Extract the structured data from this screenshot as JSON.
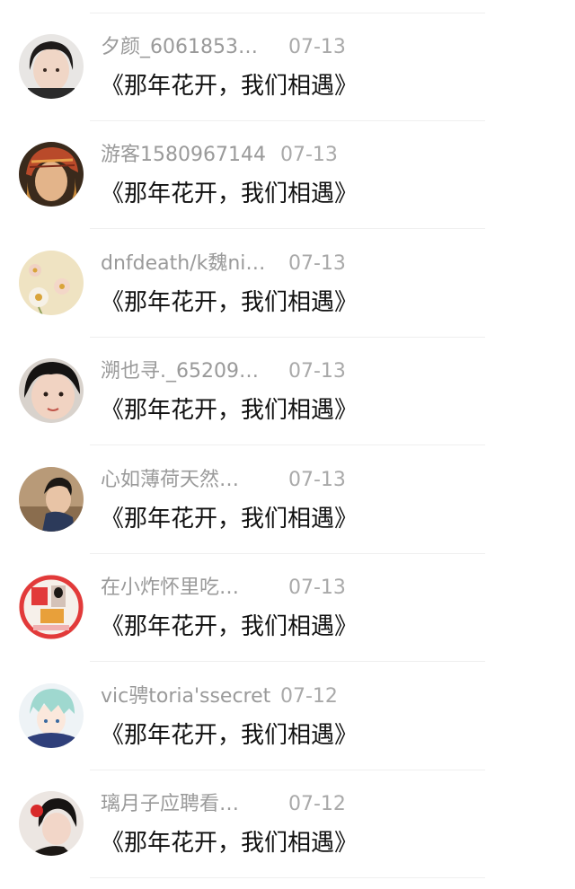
{
  "comments": [
    {
      "name": "夕颜_6061853…",
      "date": "07-13",
      "title": "《那年花开，我们相遇》",
      "avatar": "avatar-girl-short-hair"
    },
    {
      "name": "游客1580967144",
      "date": "07-13",
      "title": "《那年花开，我们相遇》",
      "avatar": "avatar-girl-red-headscarf"
    },
    {
      "name": "dnfdeath/k魏ni…",
      "date": "07-13",
      "title": "《那年花开，我们相遇》",
      "avatar": "avatar-daisy-flowers"
    },
    {
      "name": "溯也寻._65209…",
      "date": "07-13",
      "title": "《那年花开，我们相遇》",
      "avatar": "avatar-girl-close-up"
    },
    {
      "name": "心如薄荷天然…",
      "date": "07-13",
      "title": "《那年花开，我们相遇》",
      "avatar": "avatar-boy-outdoor"
    },
    {
      "name": "在小炸怀里吃…",
      "date": "07-13",
      "title": "《那年花开，我们相遇》",
      "avatar": "avatar-red-collage"
    },
    {
      "name": "vic骋toria'ssecret",
      "date": "07-12",
      "title": "《那年花开，我们相遇》",
      "avatar": "avatar-anime-boy"
    },
    {
      "name": "璃月子应聘看…",
      "date": "07-12",
      "title": "《那年花开，我们相遇》",
      "avatar": "avatar-girl-red-flower"
    }
  ]
}
